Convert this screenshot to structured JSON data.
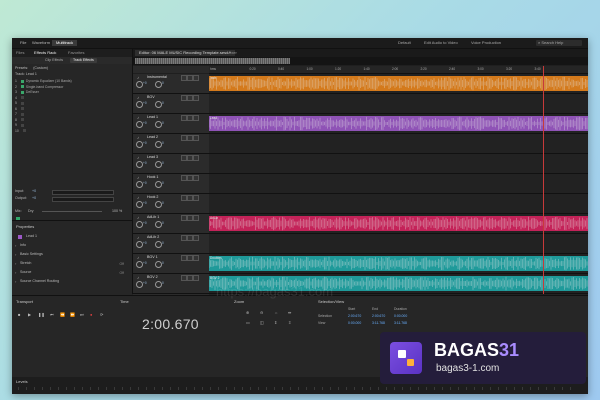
{
  "menubar": {
    "items": [
      "File",
      "Waveform",
      "Multitrack"
    ],
    "workspaces": [
      "Default",
      "Edit Audio to Video",
      "Voice Production"
    ],
    "search_label": "Search Help"
  },
  "left_panel": {
    "tabs": [
      "Files",
      "Effects Rack",
      "Favorites"
    ],
    "subtabs": [
      "Clip Effects",
      "Track Effects"
    ],
    "presets_label": "Presets:",
    "presets_value": "(Custom)",
    "track_label": "Track: Lead 1",
    "effect_slots": [
      {
        "num": "1",
        "name": "Dynamic Equalizer (10 Bands)",
        "on": true
      },
      {
        "num": "2",
        "name": "Single-band Compressor",
        "on": true
      },
      {
        "num": "3",
        "name": "DeEsser",
        "on": true
      },
      {
        "num": "4",
        "name": "",
        "on": false
      },
      {
        "num": "5",
        "name": "",
        "on": false
      },
      {
        "num": "6",
        "name": "",
        "on": false
      },
      {
        "num": "7",
        "name": "",
        "on": false
      },
      {
        "num": "8",
        "name": "",
        "on": false
      },
      {
        "num": "9",
        "name": "",
        "on": false
      },
      {
        "num": "10",
        "name": "",
        "on": false
      }
    ],
    "input_label": "Input:",
    "input_value": "+0",
    "output_label": "Output:",
    "output_value": "+0",
    "mix_label": "Mix:",
    "mix_sub": "Dry",
    "mix_value": "100 %",
    "mix_sub_right": "Wet"
  },
  "properties": {
    "title": "Properties",
    "track_name": "Lead 1",
    "items": [
      {
        "label": "Info",
        "key": ""
      },
      {
        "label": "Basic Settings",
        "key": ""
      },
      {
        "label": "Stretch",
        "key": "Off"
      },
      {
        "label": "Source",
        "key": "Off"
      },
      {
        "label": "Source Channel Routing",
        "key": ""
      }
    ]
  },
  "editor": {
    "tab_title": "Editor: 06 MALE MUSIC Recording Template.sesx *",
    "mixer_tab": "Mixer",
    "ruler_ticks": [
      "hms",
      "0:20",
      "0:40",
      "1:00",
      "1:20",
      "1:40",
      "2:00",
      "2:20",
      "2:40",
      "3:00",
      "3:20",
      "3:40"
    ],
    "tracks": [
      {
        "name": "Instrumental",
        "vol": "+0",
        "pan": "0",
        "color": "#e8841c",
        "clip_label": "Instr",
        "clips": [
          {
            "start": 0.0,
            "end": 1.0
          }
        ]
      },
      {
        "name": "BGV",
        "vol": "+0",
        "pan": "0",
        "color": "",
        "clip_label": "",
        "clips": []
      },
      {
        "name": "Lead 1",
        "vol": "+0",
        "pan": "0",
        "color": "#9b59c7",
        "clip_label": "Lead",
        "clips": [
          {
            "start": 0.0,
            "end": 1.0
          }
        ]
      },
      {
        "name": "Lead 2",
        "vol": "+0",
        "pan": "0",
        "color": "",
        "clip_label": "",
        "clips": []
      },
      {
        "name": "Lead 3",
        "vol": "+0",
        "pan": "0",
        "color": "",
        "clip_label": "",
        "clips": []
      },
      {
        "name": "Hook 1",
        "vol": "+0",
        "pan": "0",
        "color": "",
        "clip_label": "",
        "clips": []
      },
      {
        "name": "Hook 2",
        "vol": "+0",
        "pan": "0",
        "color": "",
        "clip_label": "",
        "clips": []
      },
      {
        "name": "AdLib 1",
        "vol": "+0",
        "pan": "0",
        "color": "#d6245f",
        "clip_label": "AdLib",
        "clips": [
          {
            "start": 0.0,
            "end": 1.0
          }
        ]
      },
      {
        "name": "AdLib 2",
        "vol": "+0",
        "pan": "0",
        "color": "",
        "clip_label": "",
        "clips": []
      },
      {
        "name": "BGV 1",
        "vol": "+0",
        "pan": "0",
        "color": "#1fa7a8",
        "clip_label": "Doubles",
        "clips": [
          {
            "start": 0.0,
            "end": 1.0
          }
        ]
      },
      {
        "name": "BGV 2",
        "vol": "+0",
        "pan": "0",
        "color": "#1fa7a8",
        "clip_label": "BGV 2",
        "clips": [
          {
            "start": 0.0,
            "end": 1.0
          }
        ]
      },
      {
        "name": "Reverb",
        "vol": "+0",
        "pan": "0",
        "color": "",
        "clip_label": "",
        "clips": []
      },
      {
        "name": "Mix",
        "vol": "+0",
        "pan": "0",
        "color": "",
        "clip_label": "",
        "clips": []
      }
    ]
  },
  "transport": {
    "title": "Transport",
    "time_title": "Time",
    "time_value": "2:00.670",
    "zoom_title": "Zoom"
  },
  "selection_view": {
    "title": "Selection/View",
    "headers": [
      "Start",
      "End",
      "Duration"
    ],
    "rows": [
      {
        "label": "Selection",
        "start": "2:00.670",
        "end": "2:00.670",
        "duration": "0:00.000"
      },
      {
        "label": "View",
        "start": "0:00.000",
        "end": "3:11.768",
        "duration": "3:11.768"
      }
    ]
  },
  "levels": {
    "title": "Levels"
  },
  "watermark": "https://bagas31.com",
  "badge": {
    "brand": "BAGAS",
    "brand_num": "31",
    "site": "bagas3-1.com"
  }
}
